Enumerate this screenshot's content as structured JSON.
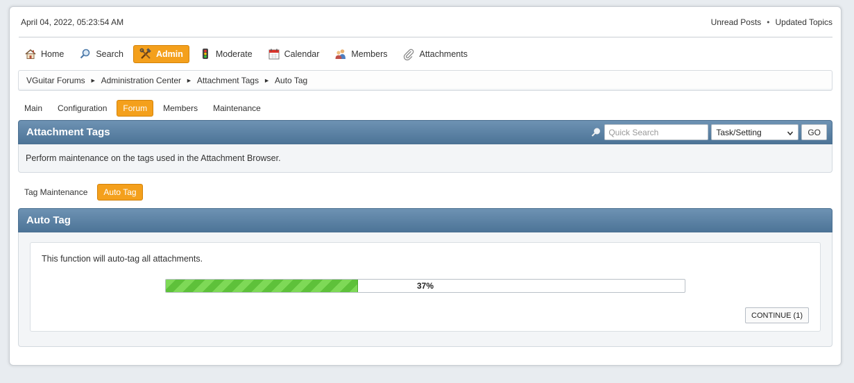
{
  "header": {
    "datetime": "April 04, 2022, 05:23:54 AM",
    "links": [
      "Unread Posts",
      "Updated Topics"
    ],
    "separator": "•"
  },
  "nav": {
    "items": [
      {
        "label": "Home",
        "icon": "home-icon"
      },
      {
        "label": "Search",
        "icon": "search-icon"
      },
      {
        "label": "Admin",
        "icon": "tools-icon",
        "active": true
      },
      {
        "label": "Moderate",
        "icon": "traffic-light-icon"
      },
      {
        "label": "Calendar",
        "icon": "calendar-icon"
      },
      {
        "label": "Members",
        "icon": "members-icon"
      },
      {
        "label": "Attachments",
        "icon": "paperclip-icon"
      }
    ]
  },
  "breadcrumb": {
    "items": [
      "VGuitar Forums",
      "Administration Center",
      "Attachment Tags",
      "Auto Tag"
    ],
    "separator": "►"
  },
  "subnav": {
    "tabs": [
      {
        "label": "Main"
      },
      {
        "label": "Configuration"
      },
      {
        "label": "Forum",
        "active": true
      },
      {
        "label": "Members"
      },
      {
        "label": "Maintenance"
      }
    ]
  },
  "tags_panel": {
    "title": "Attachment Tags",
    "quick_search_placeholder": "Quick Search",
    "select_value": "Task/Setting",
    "go_label": "GO",
    "description": "Perform maintenance on the tags used in the Attachment Browser."
  },
  "subnav2": {
    "tabs": [
      {
        "label": "Tag Maintenance"
      },
      {
        "label": "Auto Tag",
        "active": true
      }
    ]
  },
  "auto_panel": {
    "title": "Auto Tag",
    "message": "This function will auto-tag all attachments.",
    "progress_percent": 37,
    "progress_label": "37%",
    "continue_label": "CONTINUE (1)"
  },
  "colors": {
    "accent": "#f4a01c",
    "panel_header": "#5b82a6",
    "progress_green": "#6fcf48"
  }
}
